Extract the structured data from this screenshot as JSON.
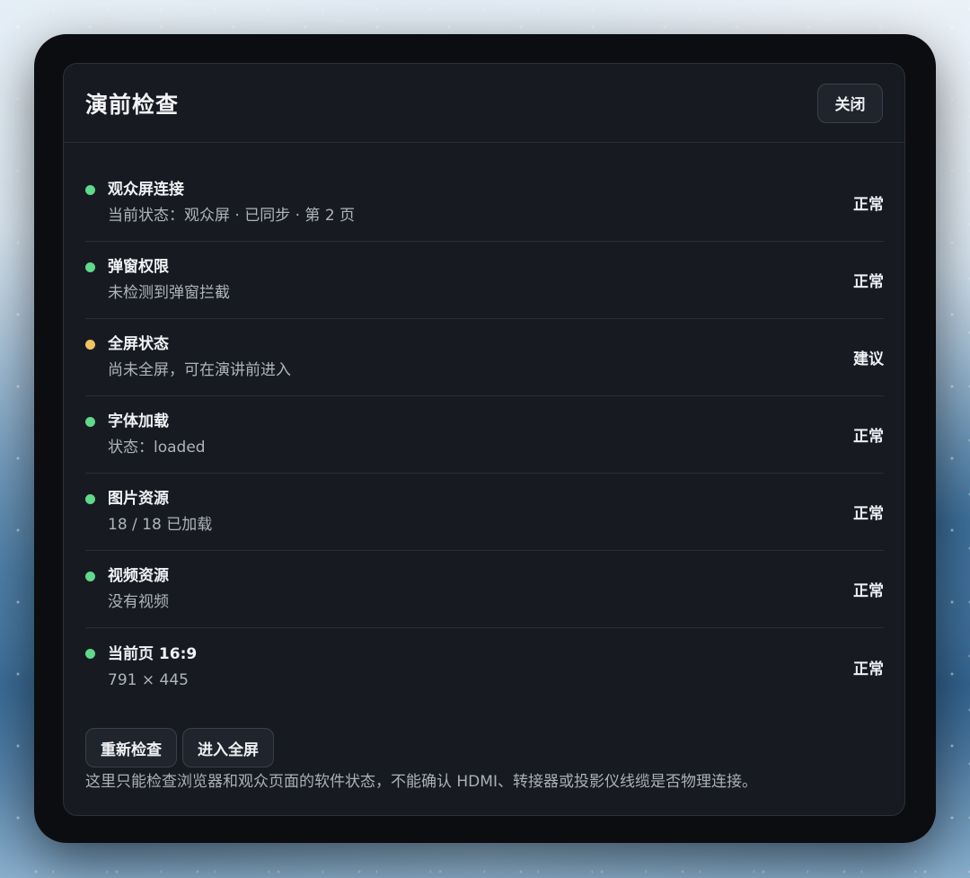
{
  "dialog": {
    "title": "演前检查",
    "close_label": "关闭"
  },
  "checks": [
    {
      "title": "观众屏连接",
      "desc": "当前状态：观众屏 · 已同步 · 第 2 页",
      "status": "正常",
      "level": "ok"
    },
    {
      "title": "弹窗权限",
      "desc": "未检测到弹窗拦截",
      "status": "正常",
      "level": "ok"
    },
    {
      "title": "全屏状态",
      "desc": "尚未全屏，可在演讲前进入",
      "status": "建议",
      "level": "warn"
    },
    {
      "title": "字体加载",
      "desc": "状态：loaded",
      "status": "正常",
      "level": "ok"
    },
    {
      "title": "图片资源",
      "desc": "18 / 18 已加载",
      "status": "正常",
      "level": "ok"
    },
    {
      "title": "视频资源",
      "desc": "没有视频",
      "status": "正常",
      "level": "ok"
    },
    {
      "title": "当前页 16:9",
      "desc": "791 × 445",
      "status": "正常",
      "level": "ok"
    }
  ],
  "footer": {
    "recheck_label": "重新检查",
    "fullscreen_label": "进入全屏",
    "note": "这里只能检查浏览器和观众页面的软件状态，不能确认 HDMI、转接器或投影仪线缆是否物理连接。"
  },
  "colors": {
    "ok": "#5fd98a",
    "warn": "#f0c460",
    "dialog_bg": "#171a21"
  }
}
